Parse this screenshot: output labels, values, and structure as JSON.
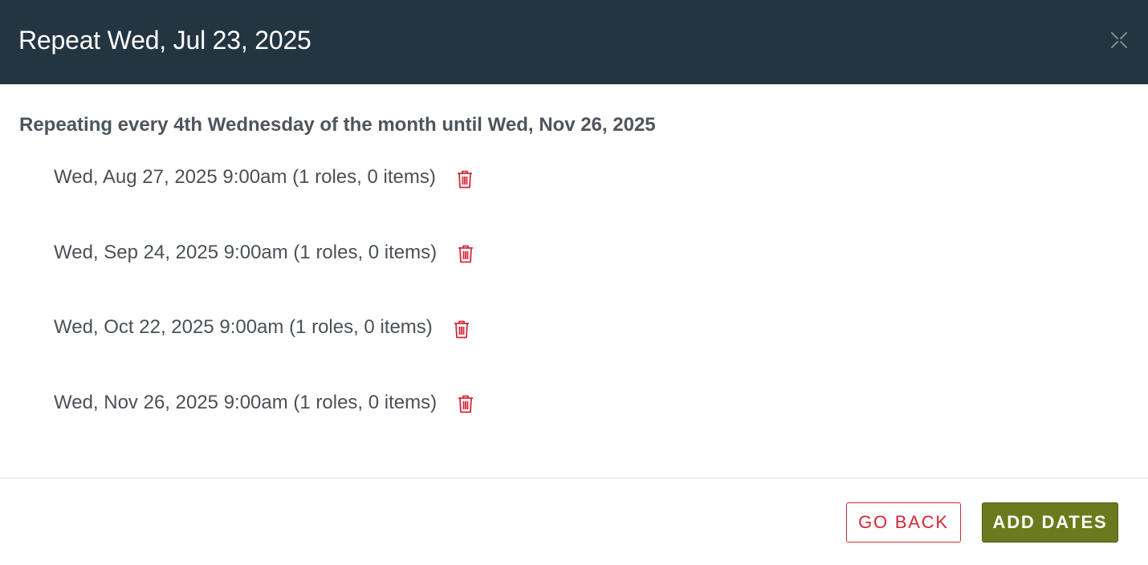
{
  "header": {
    "title": "Repeat Wed, Jul 23, 2025"
  },
  "summary": "Repeating every 4th Wednesday of the month until Wed, Nov 26, 2025",
  "dates": [
    {
      "label": "Wed, Aug 27, 2025 9:00am (1 roles, 0 items)"
    },
    {
      "label": "Wed, Sep 24, 2025 9:00am (1 roles, 0 items)"
    },
    {
      "label": "Wed, Oct 22, 2025 9:00am (1 roles, 0 items)"
    },
    {
      "label": "Wed, Nov 26, 2025 9:00am (1 roles, 0 items)"
    }
  ],
  "footer": {
    "go_back_label": "GO BACK",
    "add_dates_label": "ADD DATES"
  },
  "colors": {
    "header_bg": "#233540",
    "danger": "#d3283a",
    "primary": "#6b7a1c"
  },
  "icons": {
    "close": "close-icon",
    "delete": "trash-icon"
  }
}
